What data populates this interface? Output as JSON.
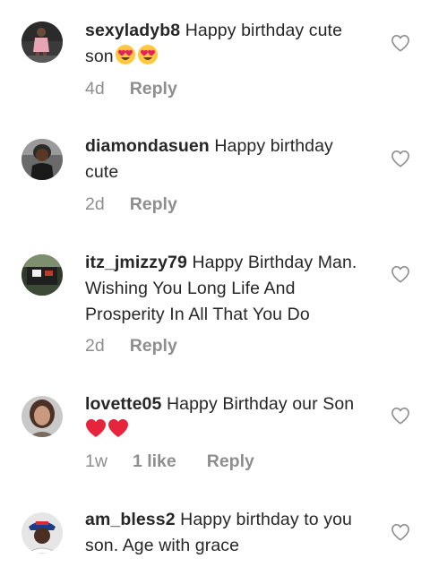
{
  "comments": [
    {
      "username": "sexyladyb8",
      "text": "Happy birthday cute son",
      "emoji": [
        "heart-eyes-emoji",
        "heart-eyes-emoji"
      ],
      "time": "4d",
      "likes": "",
      "reply": "Reply"
    },
    {
      "username": "diamondasuen",
      "text": "Happy birthday cute",
      "emoji": [],
      "time": "2d",
      "likes": "",
      "reply": "Reply"
    },
    {
      "username": "itz_jmizzy79",
      "text": "Happy Birthday Man. Wishing You Long Life And Prosperity In All That You Do",
      "emoji": [],
      "time": "2d",
      "likes": "",
      "reply": "Reply"
    },
    {
      "username": "lovette05",
      "text": "Happy Birthday our Son",
      "emoji": [
        "red-heart-emoji",
        "red-heart-emoji"
      ],
      "time": "1w",
      "likes": "1 like",
      "reply": "Reply"
    },
    {
      "username": "am_bless2",
      "text": "Happy birthday to you son. Age with grace",
      "emoji": [],
      "time": "",
      "likes": "",
      "reply": ""
    }
  ],
  "colors": {
    "text": "#262626",
    "secondary": "#8e8e8e",
    "heart": "#e0245e"
  }
}
